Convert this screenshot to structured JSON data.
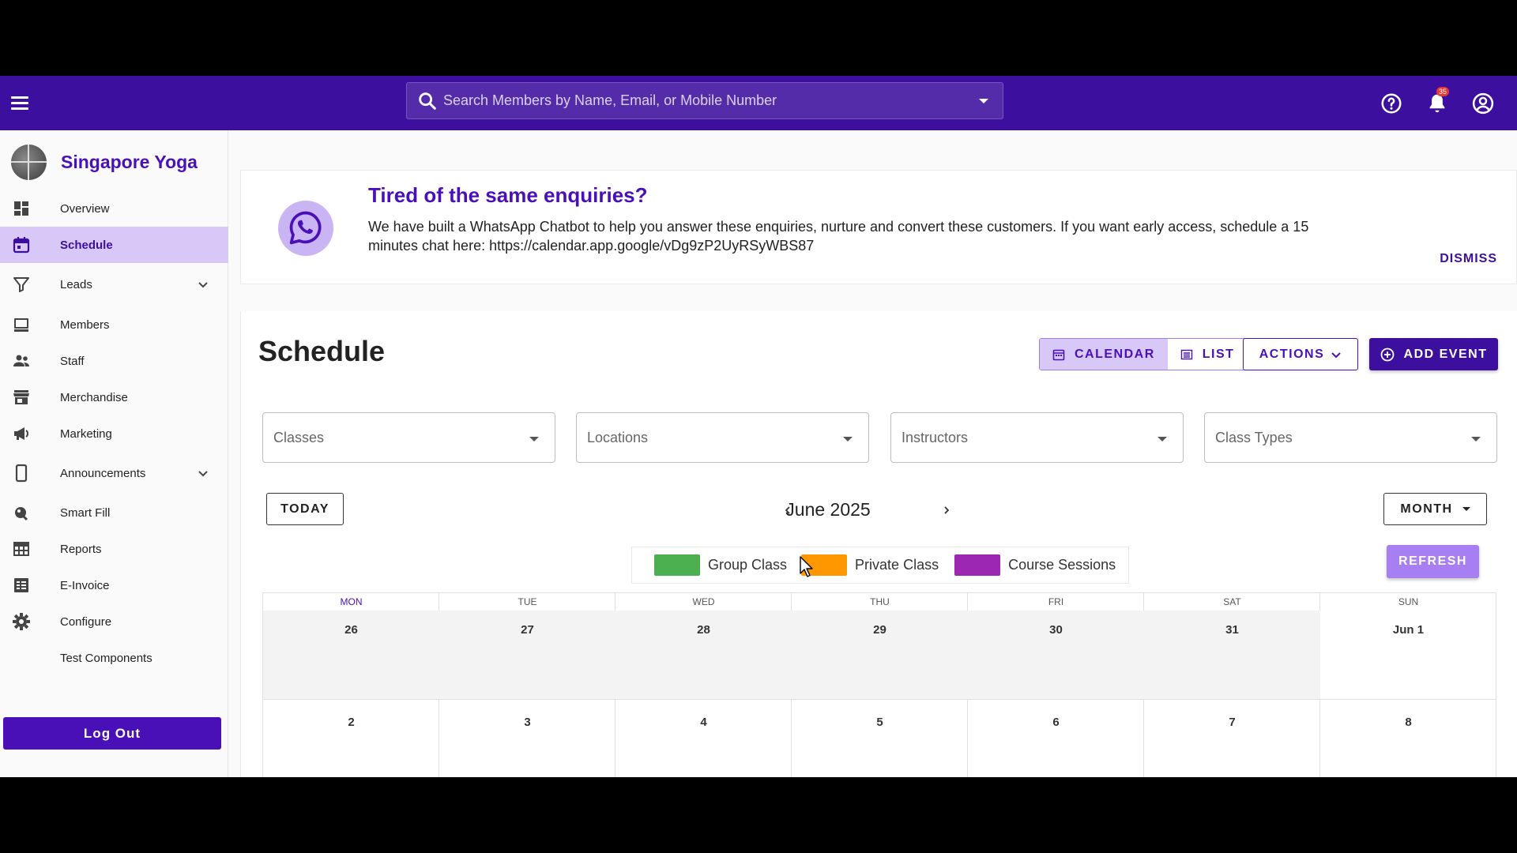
{
  "topbar": {
    "search_placeholder": "Search Members by Name, Email, or Mobile Number",
    "notification_count": "35"
  },
  "brand": {
    "name": "Singapore Yoga"
  },
  "sidebar": {
    "items": [
      {
        "label": "Overview",
        "icon": "dashboard-icon"
      },
      {
        "label": "Schedule",
        "icon": "calendar-icon",
        "active": true
      },
      {
        "label": "Leads",
        "icon": "filter-icon",
        "expandable": true
      },
      {
        "label": "Members",
        "icon": "members-icon"
      },
      {
        "label": "Staff",
        "icon": "people-icon"
      },
      {
        "label": "Merchandise",
        "icon": "store-icon"
      },
      {
        "label": "Marketing",
        "icon": "megaphone-icon"
      },
      {
        "label": "Announcements",
        "icon": "phone-icon",
        "expandable": true
      },
      {
        "label": "Smart Fill",
        "icon": "smart-fill-icon"
      },
      {
        "label": "Reports",
        "icon": "table-icon"
      },
      {
        "label": "E-Invoice",
        "icon": "invoice-icon"
      },
      {
        "label": "Configure",
        "icon": "gear-icon"
      },
      {
        "label": "Test Components",
        "icon": ""
      }
    ],
    "logout_label": "Log Out"
  },
  "banner": {
    "title": "Tired of the same enquiries?",
    "text": "We have built a WhatsApp Chatbot to help you answer these enquiries, nurture and convert these customers. If you want early access, schedule a 15 minutes chat here: https://calendar.app.google/vDg9zP2UyRSyWBS87",
    "dismiss_label": "DISMISS"
  },
  "schedule": {
    "title": "Schedule",
    "view_calendar": "CALENDAR",
    "view_list": "LIST",
    "actions_label": "ACTIONS",
    "add_event_label": "ADD EVENT",
    "filters": [
      "Classes",
      "Locations",
      "Instructors",
      "Class Types"
    ],
    "today_label": "TODAY",
    "month_label": "June 2025",
    "view_mode": "MONTH",
    "refresh_label": "REFRESH",
    "legend": [
      {
        "label": "Group Class",
        "color": "#4caf50"
      },
      {
        "label": "Private Class",
        "color": "#ff9800"
      },
      {
        "label": "Course Sessions",
        "color": "#9c27b0"
      }
    ],
    "weekdays": [
      "MON",
      "TUE",
      "WED",
      "THU",
      "FRI",
      "SAT",
      "SUN"
    ],
    "weeks": [
      [
        "26",
        "27",
        "28",
        "29",
        "30",
        "31",
        "Jun 1"
      ],
      [
        "2",
        "3",
        "4",
        "5",
        "6",
        "7",
        "8"
      ]
    ]
  },
  "colors": {
    "primary": "#3d0f9e",
    "accent_light": "#d8c8f7",
    "refresh": "#a77ff2"
  }
}
